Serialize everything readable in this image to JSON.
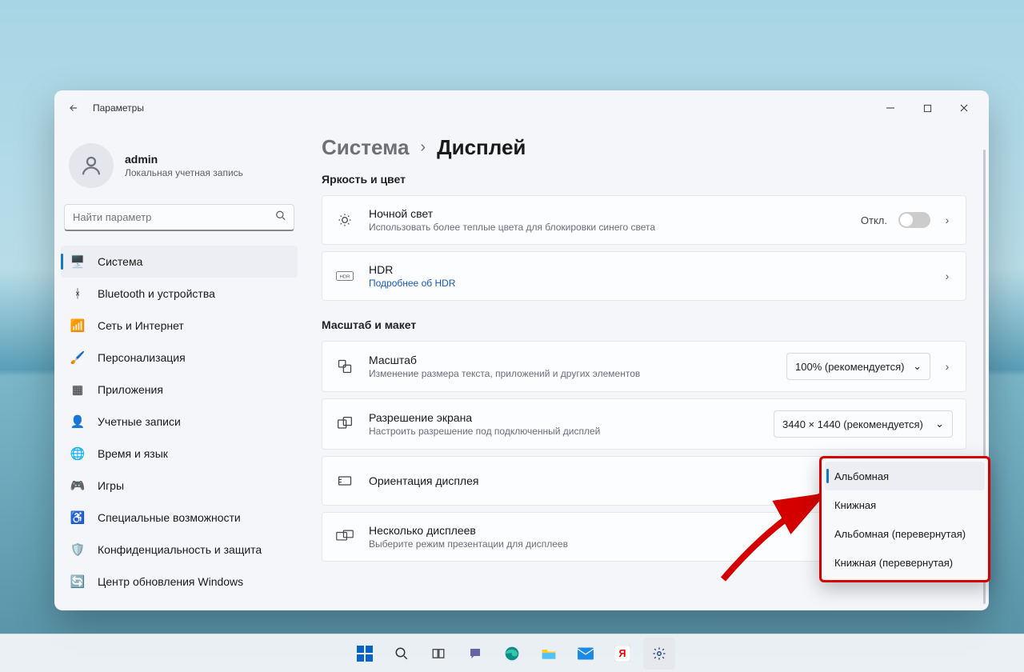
{
  "app_title": "Параметры",
  "user": {
    "name": "admin",
    "subtitle": "Локальная учетная запись"
  },
  "search": {
    "placeholder": "Найти параметр"
  },
  "nav": [
    {
      "label": "Система",
      "icon": "🖥️",
      "sel": true
    },
    {
      "label": "Bluetooth и устройства",
      "icon": "ᚼ"
    },
    {
      "label": "Сеть и Интернет",
      "icon": "📶"
    },
    {
      "label": "Персонализация",
      "icon": "🖌️"
    },
    {
      "label": "Приложения",
      "icon": "▦"
    },
    {
      "label": "Учетные записи",
      "icon": "👤"
    },
    {
      "label": "Время и язык",
      "icon": "🌐"
    },
    {
      "label": "Игры",
      "icon": "🎮"
    },
    {
      "label": "Специальные возможности",
      "icon": "♿"
    },
    {
      "label": "Конфиденциальность и защита",
      "icon": "🛡️"
    },
    {
      "label": "Центр обновления Windows",
      "icon": "🔄"
    }
  ],
  "breadcrumb": {
    "a": "Система",
    "b": "Дисплей"
  },
  "sections": {
    "brightness": "Яркость и цвет",
    "scale": "Масштаб и макет"
  },
  "cards": {
    "nightlight": {
      "title": "Ночной свет",
      "sub": "Использовать более теплые цвета для блокировки синего света",
      "toggle_label": "Откл."
    },
    "hdr": {
      "title": "HDR",
      "link": "Подробнее об HDR"
    },
    "zoom": {
      "title": "Масштаб",
      "sub": "Изменение размера текста, приложений и других элементов",
      "value": "100% (рекомендуется)"
    },
    "res": {
      "title": "Разрешение экрана",
      "sub": "Настроить разрешение под подключенный дисплей",
      "value": "3440 × 1440 (рекомендуется)"
    },
    "orient": {
      "title": "Ориентация дисплея"
    },
    "multi": {
      "title": "Несколько дисплеев",
      "sub": "Выберите режим презентации для дисплеев"
    }
  },
  "orientation_options": [
    "Альбомная",
    "Книжная",
    "Альбомная (перевернутая)",
    "Книжная (перевернутая)"
  ],
  "taskbar": [
    "start",
    "search",
    "taskview",
    "chat",
    "edge",
    "files",
    "mail",
    "y",
    "settings"
  ]
}
